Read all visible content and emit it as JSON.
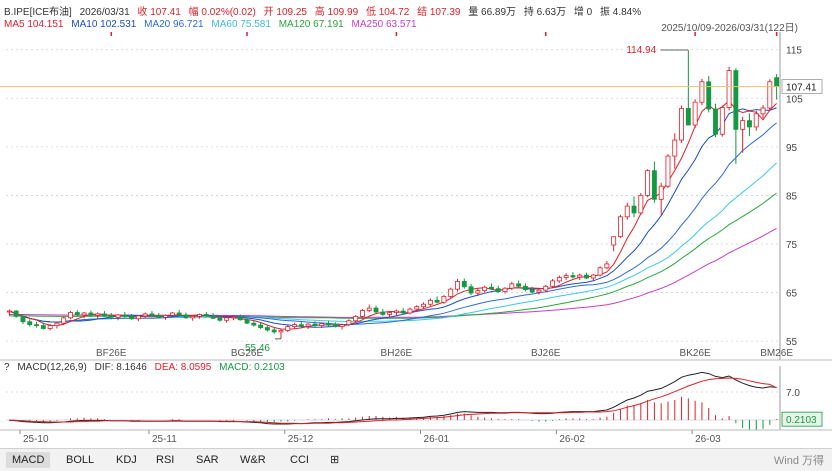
{
  "header": {
    "symbol": "B.IPE[ICE布油]",
    "date": "2026/03/31",
    "close": "收 107.41",
    "change": "幅 0.02%(0.02)",
    "open": "开 109.25",
    "high": "高 109.99",
    "low": "低 104.72",
    "settle": "结 107.39",
    "volume": "量 66.89万",
    "oi": "持 6.63万",
    "oi_change": "增 0",
    "amplitude": "振 4.84%"
  },
  "ma": {
    "ma5": "MA5 104.151",
    "ma10": "MA10 102.531",
    "ma20": "MA20 96.721",
    "ma60": "MA60 75.581",
    "ma120": "MA120 67.191",
    "ma250": "MA250 63.571",
    "range": "2025/10/09-2026/03/31(122日)"
  },
  "macd_header": {
    "question": "?",
    "title": "MACD(12,26,9)",
    "dif": "DIF: 8.1646",
    "dea": "DEA: 8.0595",
    "macd": "MACD: 0.2103"
  },
  "tabs": [
    "MACD",
    "BOLL",
    "KDJ",
    "RSI",
    "SAR",
    "W&R",
    "CCI",
    "⊞"
  ],
  "brand": "Wind 万得",
  "colors": {
    "up": "#e0202a",
    "down": "#139a42",
    "ma5": "#e0202a",
    "ma10": "#1a4fc4",
    "ma20": "#2d6bd6",
    "ma60": "#3cc8e8",
    "ma120": "#2aa63c",
    "ma250": "#c83cc8",
    "last_price_line": "#e8c46a"
  },
  "chart_data": {
    "type": "candlestick",
    "y_axis": {
      "ticks": [
        55,
        65,
        75,
        85,
        95,
        105,
        115
      ],
      "range": [
        54,
        117
      ]
    },
    "contract_labels": [
      "BF26E",
      "BG26E",
      "BH26E",
      "BJ26E",
      "BK26E",
      "BM26E"
    ],
    "date_labels": [
      "25-10",
      "25-11",
      "25-12",
      "26-01",
      "26-02",
      "26-03"
    ],
    "last_price": "107.41",
    "high_marker": "114.94",
    "low_marker": "55.46",
    "candles": [
      [
        61.0,
        61.5,
        60.2,
        61.2
      ],
      [
        61.2,
        61.4,
        59.8,
        60.1
      ],
      [
        60.1,
        60.5,
        58.5,
        59.0
      ],
      [
        59.0,
        59.5,
        58.0,
        58.4
      ],
      [
        58.4,
        59.0,
        57.8,
        58.2
      ],
      [
        58.2,
        58.8,
        57.4,
        57.6
      ],
      [
        57.6,
        58.5,
        57.2,
        58.2
      ],
      [
        58.2,
        59.0,
        57.6,
        58.7
      ],
      [
        58.7,
        60.0,
        58.3,
        59.8
      ],
      [
        59.8,
        61.2,
        59.5,
        60.9
      ],
      [
        60.9,
        61.4,
        60.1,
        60.4
      ],
      [
        60.4,
        61.0,
        59.7,
        60.8
      ],
      [
        60.8,
        61.3,
        60.0,
        60.3
      ],
      [
        60.3,
        60.9,
        59.6,
        60.6
      ],
      [
        60.6,
        61.2,
        60.0,
        60.2
      ],
      [
        60.2,
        60.8,
        59.5,
        59.9
      ],
      [
        59.9,
        60.6,
        59.3,
        60.4
      ],
      [
        60.4,
        61.0,
        59.8,
        60.1
      ],
      [
        60.1,
        60.6,
        59.4,
        59.6
      ],
      [
        59.6,
        60.3,
        59.1,
        60.2
      ],
      [
        60.2,
        60.9,
        59.8,
        60.6
      ],
      [
        60.6,
        61.2,
        60.0,
        60.3
      ],
      [
        60.3,
        60.8,
        59.7,
        59.9
      ],
      [
        59.9,
        60.5,
        59.4,
        60.3
      ],
      [
        60.3,
        61.0,
        59.9,
        60.8
      ],
      [
        60.8,
        61.4,
        60.2,
        60.4
      ],
      [
        60.4,
        60.9,
        59.6,
        59.8
      ],
      [
        59.8,
        60.4,
        59.2,
        60.1
      ],
      [
        60.1,
        60.7,
        59.6,
        60.5
      ],
      [
        60.5,
        61.0,
        59.9,
        60.2
      ],
      [
        60.2,
        60.8,
        59.6,
        59.7
      ],
      [
        59.7,
        60.2,
        59.0,
        59.3
      ],
      [
        59.3,
        60.0,
        58.8,
        59.8
      ],
      [
        59.8,
        60.4,
        59.3,
        60.0
      ],
      [
        60.0,
        60.5,
        59.2,
        59.4
      ],
      [
        59.4,
        59.9,
        58.5,
        58.7
      ],
      [
        58.7,
        59.3,
        58.0,
        58.3
      ],
      [
        58.3,
        58.9,
        57.5,
        57.8
      ],
      [
        57.8,
        58.4,
        57.0,
        57.3
      ],
      [
        57.3,
        57.9,
        56.5,
        56.9
      ],
      [
        56.9,
        57.6,
        55.5,
        57.2
      ],
      [
        57.2,
        58.3,
        56.9,
        58.0
      ],
      [
        58.0,
        58.8,
        57.5,
        58.4
      ],
      [
        58.4,
        59.0,
        57.8,
        58.1
      ],
      [
        58.1,
        58.7,
        57.5,
        58.5
      ],
      [
        58.5,
        59.1,
        57.9,
        58.2
      ],
      [
        58.2,
        58.8,
        57.7,
        58.6
      ],
      [
        58.6,
        59.2,
        58.0,
        58.3
      ],
      [
        58.3,
        58.9,
        57.8,
        58.0
      ],
      [
        58.0,
        58.6,
        57.4,
        58.4
      ],
      [
        58.4,
        59.5,
        58.1,
        59.2
      ],
      [
        59.2,
        60.4,
        58.9,
        60.1
      ],
      [
        60.1,
        61.6,
        59.8,
        61.3
      ],
      [
        61.3,
        62.5,
        61.0,
        61.8
      ],
      [
        61.8,
        62.3,
        60.8,
        61.0
      ],
      [
        61.0,
        61.6,
        60.2,
        60.5
      ],
      [
        60.5,
        61.2,
        59.9,
        60.9
      ],
      [
        60.9,
        61.5,
        60.3,
        61.2
      ],
      [
        61.2,
        61.8,
        60.6,
        60.8
      ],
      [
        60.8,
        61.9,
        60.5,
        61.6
      ],
      [
        61.6,
        62.4,
        61.1,
        62.1
      ],
      [
        62.1,
        63.0,
        61.7,
        62.6
      ],
      [
        62.6,
        63.8,
        62.2,
        63.4
      ],
      [
        63.4,
        64.2,
        62.8,
        63.0
      ],
      [
        63.0,
        64.5,
        62.7,
        64.2
      ],
      [
        64.2,
        66.0,
        63.9,
        65.7
      ],
      [
        65.7,
        67.8,
        65.2,
        67.3
      ],
      [
        67.3,
        67.9,
        65.8,
        66.2
      ],
      [
        66.2,
        66.8,
        64.5,
        64.9
      ],
      [
        64.9,
        65.8,
        64.3,
        65.4
      ],
      [
        65.4,
        66.4,
        65.0,
        66.1
      ],
      [
        66.1,
        66.9,
        65.5,
        65.8
      ],
      [
        65.8,
        66.4,
        64.9,
        65.2
      ],
      [
        65.2,
        66.1,
        64.8,
        65.9
      ],
      [
        65.9,
        67.2,
        65.5,
        66.8
      ],
      [
        66.8,
        67.5,
        66.0,
        66.3
      ],
      [
        66.3,
        66.9,
        65.2,
        65.6
      ],
      [
        65.6,
        66.2,
        64.9,
        65.1
      ],
      [
        65.1,
        65.8,
        64.6,
        65.5
      ],
      [
        65.5,
        66.6,
        65.1,
        66.3
      ],
      [
        66.3,
        67.8,
        66.0,
        67.4
      ],
      [
        67.4,
        68.5,
        67.0,
        68.1
      ],
      [
        68.1,
        69.0,
        67.6,
        68.5
      ],
      [
        68.5,
        69.2,
        67.9,
        68.2
      ],
      [
        68.2,
        68.9,
        67.6,
        68.6
      ],
      [
        68.6,
        69.1,
        67.8,
        68.0
      ],
      [
        68.0,
        68.8,
        67.5,
        68.6
      ],
      [
        68.6,
        70.4,
        68.3,
        70.1
      ],
      [
        70.1,
        71.5,
        69.8,
        70.9
      ],
      [
        74.8,
        76.0,
        73.5,
        76.5
      ],
      [
        76.5,
        81.0,
        76.2,
        80.6
      ],
      [
        80.6,
        83.5,
        80.0,
        82.8
      ],
      [
        82.8,
        84.8,
        80.5,
        81.4
      ],
      [
        81.4,
        85.5,
        81.0,
        85.0
      ],
      [
        85.0,
        90.4,
        84.6,
        90.1
      ],
      [
        90.1,
        92.0,
        83.5,
        84.2
      ],
      [
        84.2,
        87.6,
        81.0,
        86.9
      ],
      [
        86.9,
        93.5,
        86.5,
        93.1
      ],
      [
        93.1,
        97.8,
        90.5,
        96.4
      ],
      [
        96.4,
        103.5,
        95.8,
        102.9
      ],
      [
        102.9,
        114.9,
        101.6,
        99.5
      ],
      [
        99.5,
        104.8,
        98.9,
        104.2
      ],
      [
        104.2,
        109.0,
        103.6,
        108.4
      ],
      [
        108.4,
        109.6,
        102.1,
        102.8
      ],
      [
        102.8,
        103.9,
        97.0,
        97.6
      ],
      [
        97.6,
        103.5,
        97.1,
        103.1
      ],
      [
        103.1,
        111.5,
        102.5,
        110.7
      ],
      [
        110.7,
        111.2,
        91.5,
        98.6
      ],
      [
        98.6,
        101.2,
        93.8,
        100.4
      ],
      [
        100.4,
        101.9,
        97.2,
        99.1
      ],
      [
        99.1,
        102.4,
        98.3,
        101.8
      ],
      [
        101.8,
        103.6,
        100.9,
        103.0
      ],
      [
        103.0,
        108.9,
        102.4,
        108.4
      ],
      [
        109.25,
        109.99,
        104.72,
        107.41
      ]
    ],
    "macd": {
      "dif": [
        -0.1,
        -0.2,
        -0.4,
        -0.5,
        -0.6,
        -0.7,
        -0.7,
        -0.6,
        -0.5,
        -0.3,
        -0.2,
        -0.1,
        -0.1,
        -0.1,
        -0.1,
        -0.2,
        -0.2,
        -0.2,
        -0.3,
        -0.3,
        -0.3,
        -0.3,
        -0.3,
        -0.3,
        -0.2,
        -0.2,
        -0.3,
        -0.3,
        -0.3,
        -0.3,
        -0.3,
        -0.4,
        -0.4,
        -0.4,
        -0.4,
        -0.5,
        -0.6,
        -0.7,
        -0.9,
        -1.0,
        -1.0,
        -1.0,
        -0.9,
        -0.9,
        -0.8,
        -0.7,
        -0.7,
        -0.6,
        -0.6,
        -0.5,
        -0.4,
        -0.2,
        0.0,
        0.2,
        0.3,
        0.3,
        0.3,
        0.4,
        0.4,
        0.5,
        0.6,
        0.7,
        0.9,
        1.0,
        1.2,
        1.5,
        1.9,
        2.1,
        2.0,
        1.9,
        1.9,
        1.9,
        1.8,
        1.8,
        1.9,
        1.9,
        1.8,
        1.7,
        1.6,
        1.6,
        1.7,
        1.9,
        2.0,
        2.1,
        2.1,
        2.1,
        2.1,
        2.3,
        2.5,
        3.2,
        4.1,
        5.0,
        5.5,
        6.2,
        7.2,
        7.5,
        7.9,
        8.7,
        9.6,
        10.7,
        11.2,
        11.5,
        11.9,
        11.6,
        10.9,
        10.6,
        11.0,
        10.0,
        9.2,
        8.6,
        8.2,
        8.0,
        8.3,
        8.16
      ],
      "dea": [
        -0.0,
        -0.1,
        -0.2,
        -0.3,
        -0.4,
        -0.4,
        -0.5,
        -0.5,
        -0.5,
        -0.5,
        -0.4,
        -0.4,
        -0.3,
        -0.3,
        -0.2,
        -0.2,
        -0.2,
        -0.2,
        -0.2,
        -0.2,
        -0.3,
        -0.3,
        -0.3,
        -0.3,
        -0.3,
        -0.3,
        -0.3,
        -0.3,
        -0.3,
        -0.3,
        -0.3,
        -0.3,
        -0.3,
        -0.3,
        -0.4,
        -0.4,
        -0.4,
        -0.5,
        -0.6,
        -0.7,
        -0.8,
        -0.8,
        -0.8,
        -0.9,
        -0.9,
        -0.8,
        -0.8,
        -0.8,
        -0.7,
        -0.7,
        -0.6,
        -0.5,
        -0.4,
        -0.3,
        -0.2,
        -0.1,
        0.0,
        0.0,
        0.1,
        0.2,
        0.3,
        0.4,
        0.5,
        0.6,
        0.7,
        0.9,
        1.1,
        1.3,
        1.4,
        1.5,
        1.6,
        1.7,
        1.7,
        1.7,
        1.8,
        1.8,
        1.8,
        1.8,
        1.8,
        1.8,
        1.8,
        1.8,
        1.8,
        1.9,
        1.9,
        2.0,
        2.0,
        2.0,
        2.1,
        2.3,
        2.7,
        3.2,
        3.6,
        4.1,
        4.7,
        5.3,
        5.8,
        6.4,
        7.1,
        7.8,
        8.5,
        9.1,
        9.7,
        10.1,
        10.3,
        10.4,
        10.5,
        10.4,
        10.2,
        9.8,
        9.4,
        9.1,
        8.9,
        8.06
      ]
    }
  }
}
